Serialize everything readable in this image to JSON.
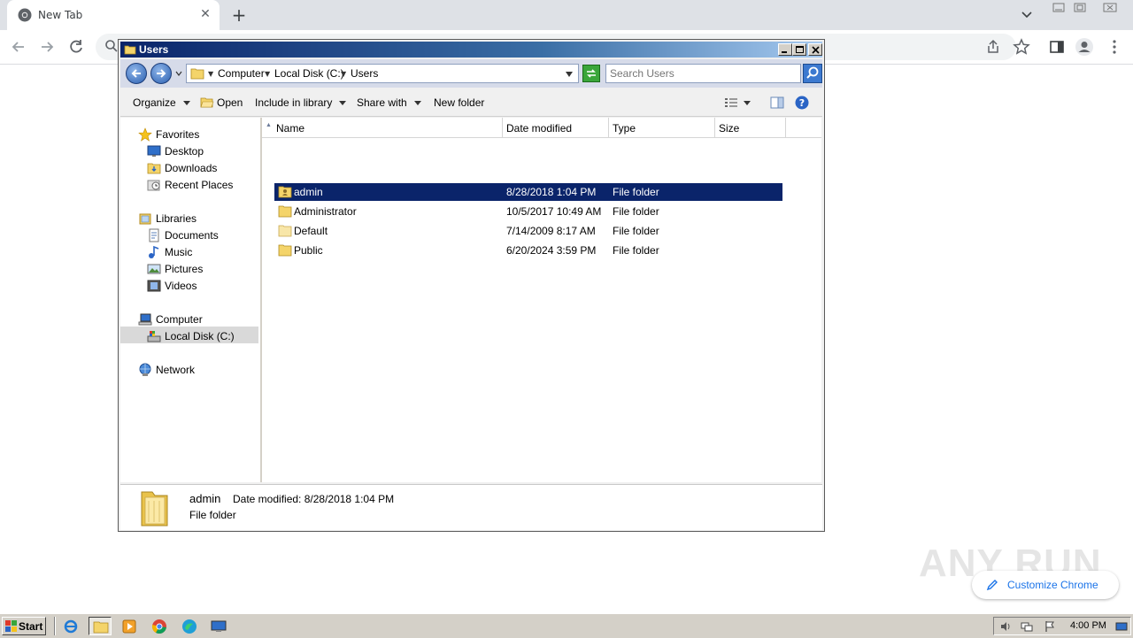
{
  "browser": {
    "tab_title": "New Tab",
    "customize_label": "Customize Chrome"
  },
  "explorer": {
    "window_title": "Users",
    "breadcrumbs": [
      "Computer",
      "Local Disk (C:)",
      "Users"
    ],
    "search_placeholder": "Search Users",
    "commands": {
      "organize": "Organize",
      "open": "Open",
      "include_in_library": "Include in library",
      "share_with": "Share with",
      "new_folder": "New folder"
    },
    "nav": {
      "favorites": "Favorites",
      "desktop": "Desktop",
      "downloads": "Downloads",
      "recent_places": "Recent Places",
      "libraries": "Libraries",
      "documents": "Documents",
      "music": "Music",
      "pictures": "Pictures",
      "videos": "Videos",
      "computer": "Computer",
      "local_disk": "Local Disk (C:)",
      "network": "Network"
    },
    "columns": {
      "name": "Name",
      "date_modified": "Date modified",
      "type": "Type",
      "size": "Size"
    },
    "files": [
      {
        "name": "admin",
        "date": "8/28/2018 1:04 PM",
        "type": "File folder"
      },
      {
        "name": "Administrator",
        "date": "10/5/2017 10:49 AM",
        "type": "File folder"
      },
      {
        "name": "Default",
        "date": "7/14/2009 8:17 AM",
        "type": "File folder"
      },
      {
        "name": "Public",
        "date": "6/20/2024 3:59 PM",
        "type": "File folder"
      }
    ],
    "details": {
      "name": "admin",
      "date_modified": "Date modified: 8/28/2018 1:04 PM",
      "type": "File folder"
    }
  },
  "watermark": "ANY RUN",
  "taskbar": {
    "start_label": "Start",
    "clock": "4:00 PM"
  },
  "colors": {
    "selection": "#0a246a",
    "chrome_tabstrip": "#dee1e6",
    "link_blue": "#1a73e8"
  }
}
